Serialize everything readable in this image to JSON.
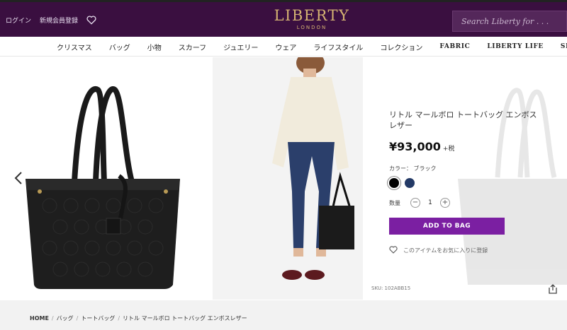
{
  "header": {
    "login": "ログイン",
    "register": "新規会員登録",
    "logo_main": "LIBERTY",
    "logo_sub": "LONDON",
    "search_placeholder": "Search Liberty for . . ."
  },
  "nav": {
    "items": [
      "クリスマス",
      "バッグ",
      "小物",
      "スカーフ",
      "ジュエリー",
      "ウェア",
      "ライフスタイル",
      "コレクション",
      "FABRIC",
      "LIBERTY LIFE",
      "SPECIAL"
    ]
  },
  "product": {
    "title": "リトル マールボロ トートバッグ エンボスレザー",
    "price": "¥93,000",
    "tax_label": "+税",
    "color_label": "カラー：",
    "color_value": "ブラック",
    "swatches": [
      {
        "name": "ブラック",
        "color": "#000000"
      },
      {
        "name": "ネイビー",
        "color": "#243a66"
      }
    ],
    "quantity_label": "数量",
    "quantity_value": "1",
    "add_to_bag": "ADD TO BAG",
    "favorite_label": "このアイテムをお気に入りに登録",
    "sku": "SKU: 102ABB15"
  },
  "breadcrumb": [
    "HOME",
    "バッグ",
    "トートバッグ",
    "リトル マールボロ トートバッグ エンボスレザー"
  ],
  "colors": {
    "header_bg": "#3a0f40",
    "brand_gold": "#d4b372",
    "accent_purple": "#7b1fa2"
  }
}
